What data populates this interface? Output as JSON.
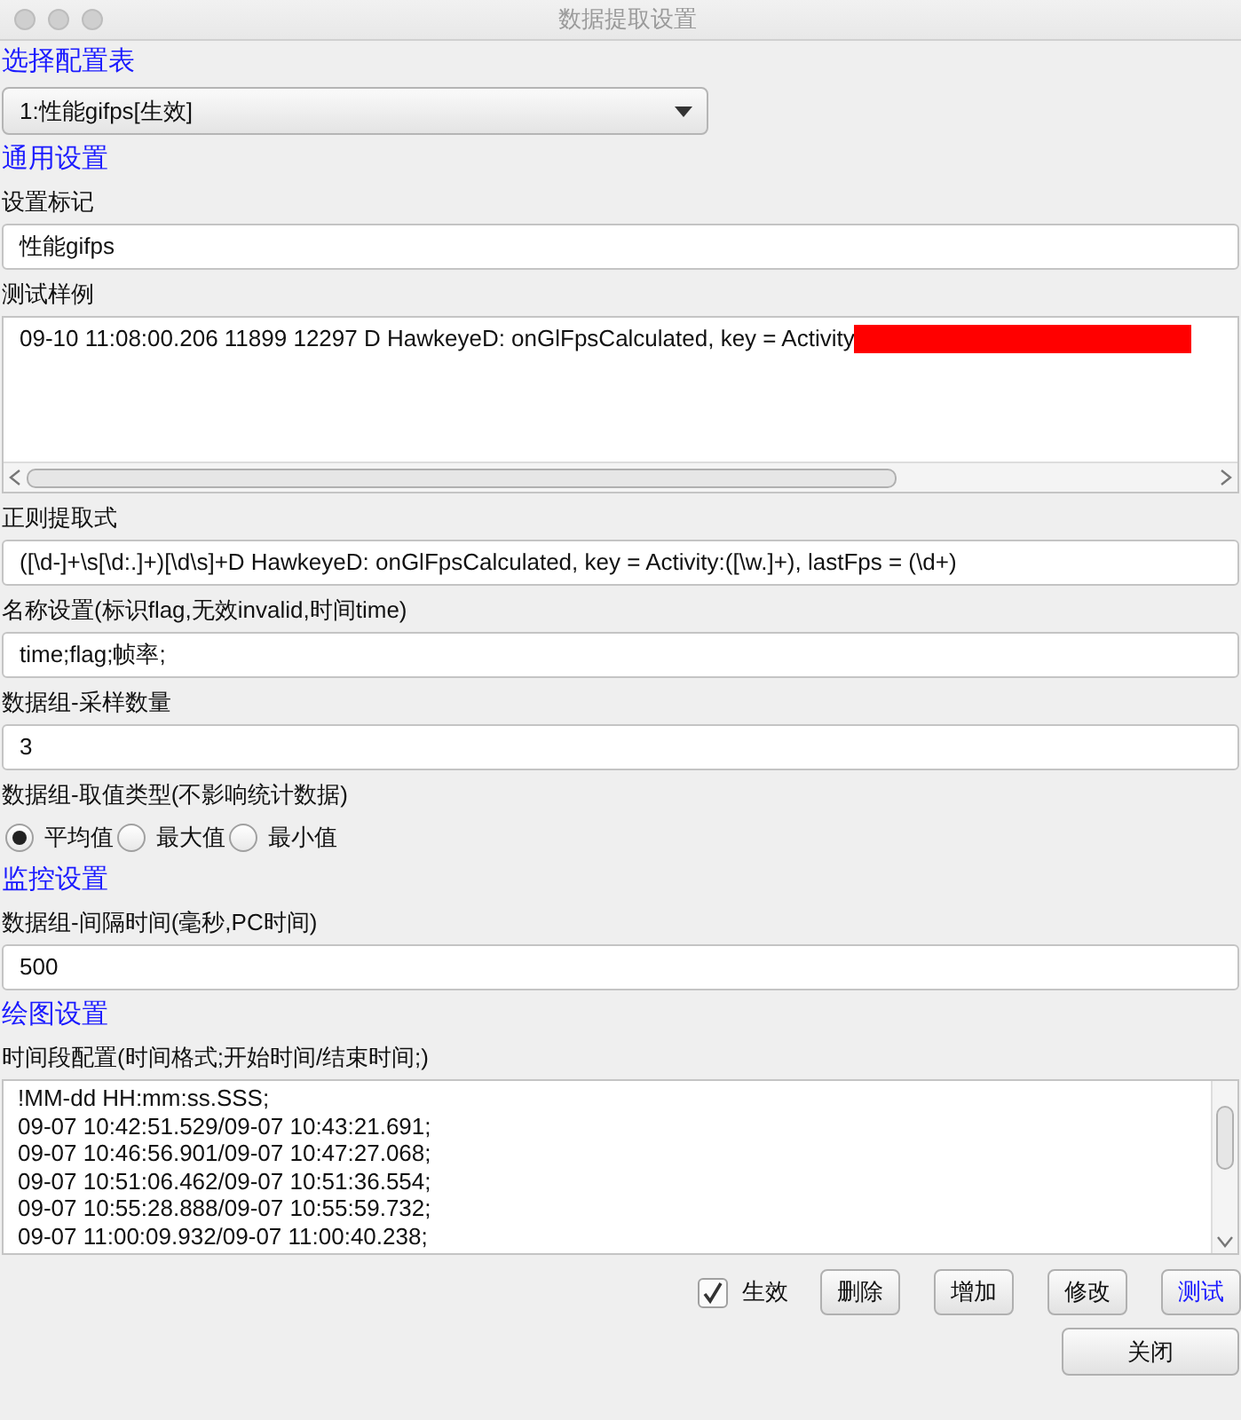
{
  "window": {
    "title": "数据提取设置"
  },
  "items": [
    {
      "kind": "heading",
      "text": "选择配置表"
    },
    {
      "kind": "dropdown",
      "value": "1:性能gifps[生效]"
    },
    {
      "kind": "heading",
      "text": "通用设置"
    },
    {
      "kind": "label",
      "text": "设置标记"
    },
    {
      "kind": "field",
      "value": "性能gifps"
    },
    {
      "kind": "label",
      "text": "测试样例"
    },
    {
      "kind": "sample",
      "value": "09-10 11:08:00.206 11899 12297 D HawkeyeD: onGlFpsCalculated, key = Activity"
    },
    {
      "kind": "label",
      "text": "正则提取式"
    },
    {
      "kind": "field",
      "value": "([\\d-]+\\s[\\d:.]+)[\\d\\s]+D HawkeyeD: onGlFpsCalculated, key = Activity:([\\w.]+), lastFps = (\\d+)"
    },
    {
      "kind": "label",
      "text": "名称设置(标识flag,无效invalid,时间time)"
    },
    {
      "kind": "field",
      "value": "time;flag;帧率;"
    },
    {
      "kind": "label",
      "text": "数据组-采样数量"
    },
    {
      "kind": "field",
      "value": "3"
    },
    {
      "kind": "label",
      "text": "数据组-取值类型(不影响统计数据)"
    },
    {
      "kind": "radios",
      "options": [
        {
          "label": "平均值",
          "selected": true
        },
        {
          "label": "最大值",
          "selected": false
        },
        {
          "label": "最小值",
          "selected": false
        }
      ]
    },
    {
      "kind": "heading",
      "text": "监控设置"
    },
    {
      "kind": "label",
      "text": "数据组-间隔时间(毫秒,PC时间)"
    },
    {
      "kind": "field",
      "value": "500"
    },
    {
      "kind": "heading",
      "text": "绘图设置"
    },
    {
      "kind": "label",
      "text": "时间段配置(时间格式;开始时间/结束时间;)"
    },
    {
      "kind": "textarea",
      "lines": [
        "!MM-dd HH:mm:ss.SSS;",
        "09-07 10:42:51.529/09-07 10:43:21.691;",
        "09-07 10:46:56.901/09-07 10:47:27.068;",
        "09-07 10:51:06.462/09-07 10:51:36.554;",
        "09-07 10:55:28.888/09-07 10:55:59.732;",
        "09-07 11:00:09.932/09-07 11:00:40.238;"
      ]
    }
  ],
  "enabled_checkbox": {
    "label": "生效",
    "checked": true
  },
  "buttons": [
    {
      "label": "删除",
      "kind": "plain"
    },
    {
      "label": "增加",
      "kind": "plain"
    },
    {
      "label": "修改",
      "kind": "plain"
    },
    {
      "label": "测试",
      "kind": "accent"
    }
  ],
  "close_button": {
    "label": "关闭"
  }
}
